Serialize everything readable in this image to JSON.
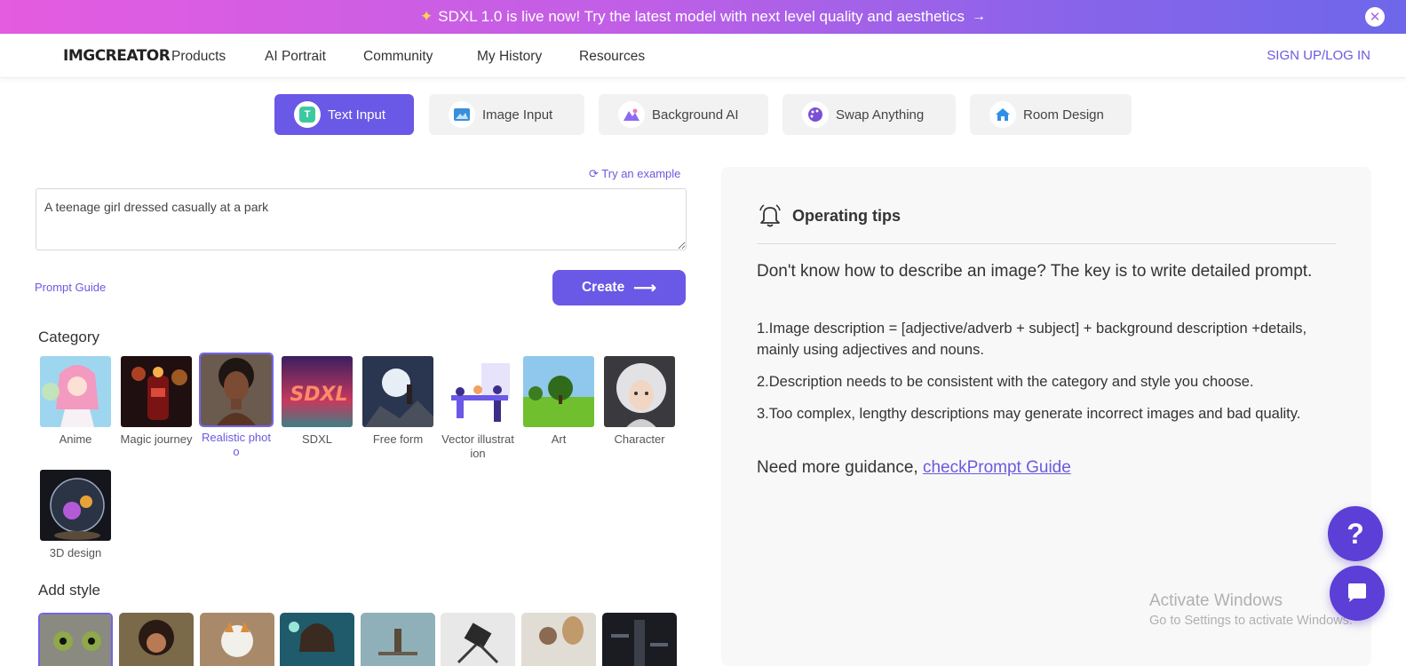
{
  "banner": {
    "text": "SDXL 1.0 is live now! Try the latest model with next level quality and aesthetics",
    "spark_icon": "sparkle-icon",
    "arrow": "→",
    "close": "✕"
  },
  "nav": {
    "logo": "IMGCREATOR",
    "items": [
      "Products",
      "AI Portrait",
      "Community",
      "My History",
      "Resources"
    ],
    "login": "SIGN UP/LOG IN"
  },
  "tabs": [
    {
      "label": "Text Input",
      "icon": "text-icon",
      "active": true
    },
    {
      "label": "Image Input",
      "icon": "image-icon",
      "active": false
    },
    {
      "label": "Background AI",
      "icon": "background-icon",
      "active": false
    },
    {
      "label": "Swap Anything",
      "icon": "palette-icon",
      "active": false
    },
    {
      "label": "Room Design",
      "icon": "house-icon",
      "active": false
    }
  ],
  "prompt": {
    "try_example": "Try an example",
    "value": "A teenage girl dressed casually at a park",
    "guide": "Prompt Guide",
    "create": "Create",
    "create_arrow": "⟶"
  },
  "category": {
    "title": "Category",
    "items": [
      {
        "label": "Anime",
        "selected": false
      },
      {
        "label": "Magic journey",
        "selected": false
      },
      {
        "label": "Realistic photo",
        "selected": true
      },
      {
        "label": "SDXL",
        "selected": false
      },
      {
        "label": "Free form",
        "selected": false
      },
      {
        "label": "Vector illustration",
        "selected": false
      },
      {
        "label": "Art",
        "selected": false
      },
      {
        "label": "Character",
        "selected": false
      },
      {
        "label": "3D design",
        "selected": false
      }
    ],
    "sdxl_text": "SDXL"
  },
  "add_style": {
    "title": "Add style",
    "count": 8
  },
  "tips": {
    "title": "Operating tips",
    "lead": "Don't know how to describe an image? The key is to write detailed prompt.",
    "items": [
      "1.Image description = [adjective/adverb + subject] + background description +details, mainly using adjectives and nouns.",
      "2.Description needs to be consistent with the category and style you choose.",
      "3.Too complex, lengthy descriptions may generate incorrect images and bad quality."
    ],
    "more_prefix": "Need more guidance, ",
    "more_link": "checkPrompt Guide"
  },
  "watermark": {
    "line1": "Activate Windows",
    "line2": "Go to Settings to activate Windows."
  },
  "fab": {
    "help": "?"
  }
}
